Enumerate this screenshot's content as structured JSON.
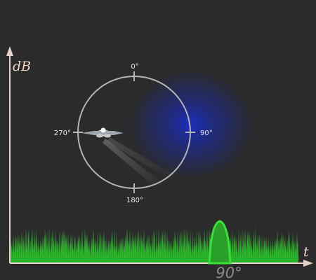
{
  "axes": {
    "y_label": "dB",
    "x_label": "t"
  },
  "compass": {
    "north": "0°",
    "east": "90°",
    "south": "180°",
    "west": "270°"
  },
  "bearing_readout": "90°",
  "colors": {
    "background": "#2b2b2b",
    "axis": "#e6d2c8",
    "circle": "#b4b4b4",
    "noise": "#2fc12f",
    "signal_peak": "#35d835",
    "sound_source": "#1a2fd6"
  },
  "icons": {
    "aircraft": "airplane-icon"
  }
}
